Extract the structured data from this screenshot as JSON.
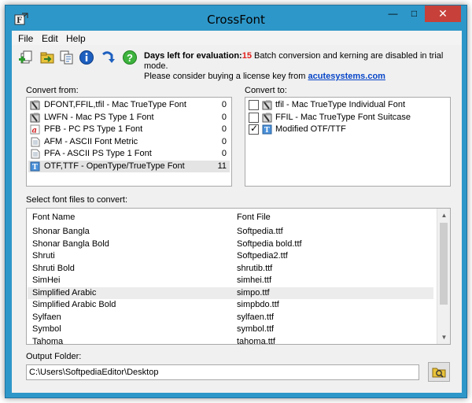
{
  "window": {
    "title": "CrossFont"
  },
  "menu": [
    "File",
    "Edit",
    "Help"
  ],
  "toolbar": {
    "icons": [
      "add-files-icon",
      "convert-icon",
      "copy-icon",
      "info-icon",
      "refresh-icon",
      "help-icon"
    ]
  },
  "notice": {
    "days_label": "Days left for evaluation:",
    "days_value": "15",
    "line1_rest": "Batch conversion and kerning are disabled in trial mode.",
    "line2_prefix": "Please consider buying a license key from",
    "link": "acutesystems.com"
  },
  "convert_from": {
    "label": "Convert from:",
    "items": [
      {
        "label": "DFONT,FFIL,tfil - Mac TrueType Font",
        "count": "0",
        "icon": "mac-font-icon"
      },
      {
        "label": "LWFN - Mac PS Type 1 Font",
        "count": "0",
        "icon": "mac-font-icon"
      },
      {
        "label": "PFB - PC PS Type 1 Font",
        "count": "0",
        "icon": "pfb-font-icon"
      },
      {
        "label": "AFM - ASCII Font Metric",
        "count": "0",
        "icon": "document-icon"
      },
      {
        "label": "PFA - ASCII PS Type 1 Font",
        "count": "0",
        "icon": "document-icon"
      },
      {
        "label": "OTF,TTF - OpenType/TrueType Font",
        "count": "11",
        "icon": "otf-font-icon",
        "selected": true
      }
    ]
  },
  "convert_to": {
    "label": "Convert to:",
    "items": [
      {
        "label": "tfil - Mac TrueType Individual Font",
        "checked": false
      },
      {
        "label": "FFIL - Mac TrueType Font Suitcase",
        "checked": false
      },
      {
        "label": "Modified OTF/TTF",
        "checked": true
      }
    ]
  },
  "files": {
    "label": "Select font files to convert:",
    "col_name": "Font Name",
    "col_file": "Font File",
    "rows": [
      {
        "name": "Shonar Bangla",
        "file": "Softpedia.ttf"
      },
      {
        "name": "Shonar Bangla Bold",
        "file": "Softpedia bold.ttf"
      },
      {
        "name": "Shruti",
        "file": "Softpedia2.ttf"
      },
      {
        "name": "Shruti Bold",
        "file": "shrutib.ttf"
      },
      {
        "name": "SimHei",
        "file": "simhei.ttf"
      },
      {
        "name": "Simplified Arabic",
        "file": "simpo.ttf",
        "selected": true
      },
      {
        "name": "Simplified Arabic Bold",
        "file": "simpbdo.ttf"
      },
      {
        "name": "Sylfaen",
        "file": "sylfaen.ttf"
      },
      {
        "name": "Symbol",
        "file": "symbol.ttf"
      },
      {
        "name": "Tahoma",
        "file": "tahoma.ttf"
      }
    ]
  },
  "output": {
    "label": "Output Folder:",
    "value": "C:\\Users\\SoftpediaEditor\\Desktop"
  },
  "colors": {
    "titlebar": "#2e97c9",
    "close": "#c7413a",
    "accent_red": "#e0201b",
    "link": "#0645c8"
  }
}
